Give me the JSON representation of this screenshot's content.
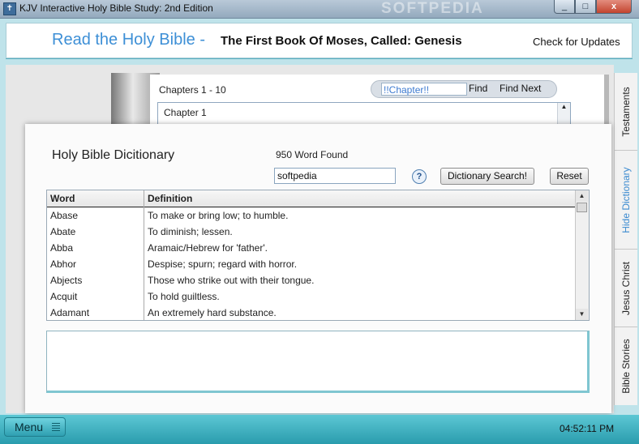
{
  "window": {
    "title": "KJV Interactive Holy Bible Study: 2nd Edition",
    "watermark": "SOFTPEDIA",
    "controls": {
      "minimize": "_",
      "maximize": "□",
      "close": "x"
    }
  },
  "header": {
    "read_title": "Read the Holy Bible -",
    "book_title": "The First Book Of Moses, Called: Genesis",
    "check_updates": "Check for Updates"
  },
  "chapters": {
    "range_label": "Chapters 1 - 10",
    "search_value": "!!Chapter!!",
    "find_label": "Find",
    "find_next_label": "Find Next",
    "items": [
      "Chapter 1"
    ]
  },
  "side_tabs": {
    "testaments": "Testaments",
    "hide_dictionary": "Hide Dictionary",
    "jesus_christ": "Jesus Christ",
    "bible_stories": "Bible Stories"
  },
  "dictionary": {
    "title": "Holy Bible Dicitionary",
    "word_count": "950 Word Found",
    "search_value": "softpedia",
    "help_label": "?",
    "search_button": "Dictionary Search!",
    "reset_button": "Reset",
    "columns": {
      "word": "Word",
      "definition": "Definition"
    },
    "rows": [
      {
        "word": "Abase",
        "definition": "To make or bring low; to humble."
      },
      {
        "word": "Abate",
        "definition": "To diminish; lessen."
      },
      {
        "word": "Abba",
        "definition": "Aramaic/Hebrew for 'father'."
      },
      {
        "word": "Abhor",
        "definition": "Despise; spurn; regard with horror."
      },
      {
        "word": "Abjects",
        "definition": "Those who strike out with their tongue."
      },
      {
        "word": "Acquit",
        "definition": "To hold guiltless."
      },
      {
        "word": "Adamant",
        "definition": "An extremely hard substance."
      }
    ],
    "definition_text": ""
  },
  "bottom_bar": {
    "menu_label": "Menu",
    "clock": "04:52:11 PM"
  },
  "colors": {
    "accent_blue": "#3d8fd6",
    "bottom_bar": "#2a9cad",
    "close_button": "#c3442f"
  },
  "icons": {
    "app": "bible-app-icon",
    "help": "help-icon",
    "menu_grip": "grip-icon"
  }
}
